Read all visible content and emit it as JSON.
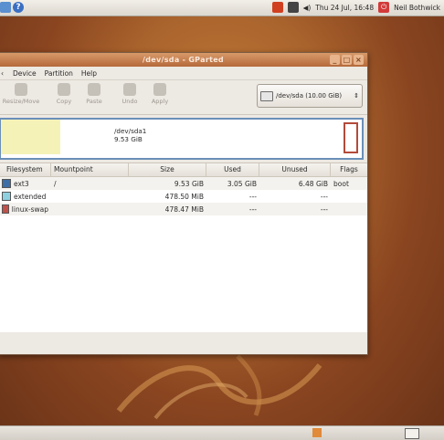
{
  "top_panel": {
    "clock": "Thu 24 Jul, 16:48",
    "user": "Neil Bothwick"
  },
  "window": {
    "title": "/dev/sda - GParted",
    "menu": [
      "Device",
      "Partition",
      "Help"
    ],
    "toolbar": [
      {
        "label": "Resize/Move"
      },
      {
        "label": "Copy"
      },
      {
        "label": "Paste"
      },
      {
        "label": "Undo"
      },
      {
        "label": "Apply"
      }
    ],
    "device_selector": "/dev/sda  (10.00 GiB)",
    "partition_map": {
      "name": "/dev/sda1",
      "size": "9.53 GiB"
    },
    "table": {
      "headers": [
        "Filesystem",
        "Mountpoint",
        "Size",
        "Used",
        "Unused",
        "Flags"
      ],
      "rows": [
        {
          "filesystem": "ext3",
          "color": "#3d6ea5",
          "mountpoint": "/",
          "size": "9.53 GiB",
          "used": "3.05 GiB",
          "unused": "6.48 GiB",
          "flags": "boot"
        },
        {
          "filesystem": "extended",
          "color": "#8fd0e0",
          "mountpoint": "",
          "size": "478.50 MiB",
          "used": "---",
          "unused": "---",
          "flags": ""
        },
        {
          "filesystem": "linux-swap",
          "color": "#c0504a",
          "mountpoint": "",
          "size": "478.47 MiB",
          "used": "---",
          "unused": "---",
          "flags": ""
        }
      ]
    }
  },
  "colors": {
    "titlebar": "#c57c4a",
    "desktop": "#a8622c",
    "diskmap_border": "#6a8fb8"
  }
}
